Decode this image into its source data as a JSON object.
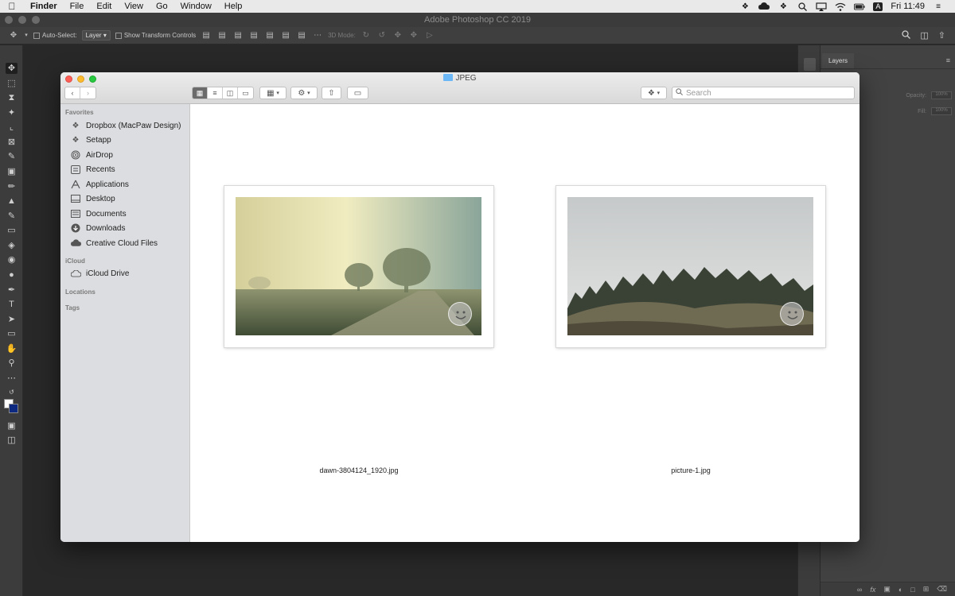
{
  "menubar": {
    "apple": "",
    "app": "Finder",
    "items": [
      "File",
      "Edit",
      "View",
      "Go",
      "Window",
      "Help"
    ],
    "clock": "Fri 11:49",
    "status_icons": [
      "dropbox-status-icon",
      "creative-cloud-icon",
      "dropbox-icon",
      "search-icon",
      "airplay-icon",
      "wifi-icon",
      "battery-icon",
      "input-source-icon",
      "notification-center-icon"
    ],
    "input_source": "A"
  },
  "photoshop": {
    "title": "Adobe Photoshop CC 2019",
    "options": {
      "auto_select_label": "Auto-Select:",
      "layer_value": "Layer",
      "transform_label": "Show Transform Controls",
      "mode_3d_label": "3D Mode:"
    },
    "layers_tab": "Layers",
    "opacity_label": "Opacity:",
    "opacity_value": "100%",
    "fill_label": "Fill:",
    "fill_value": "100%",
    "colors": {
      "foreground": "#ffffff",
      "background": "#0d2a80"
    }
  },
  "finder": {
    "title": "JPEG",
    "search_placeholder": "Search",
    "sidebar": {
      "favorites_header": "Favorites",
      "favorites": [
        {
          "label": "Dropbox (MacPaw Design)",
          "icon": "dropbox-icon"
        },
        {
          "label": "Setapp",
          "icon": "setapp-icon"
        },
        {
          "label": "AirDrop",
          "icon": "airdrop-icon"
        },
        {
          "label": "Recents",
          "icon": "recents-icon"
        },
        {
          "label": "Applications",
          "icon": "applications-icon"
        },
        {
          "label": "Desktop",
          "icon": "desktop-icon"
        },
        {
          "label": "Documents",
          "icon": "documents-icon"
        },
        {
          "label": "Downloads",
          "icon": "downloads-icon"
        },
        {
          "label": "Creative Cloud Files",
          "icon": "creative-cloud-icon"
        }
      ],
      "icloud_header": "iCloud",
      "icloud": [
        {
          "label": "iCloud Drive",
          "icon": "cloud-icon"
        }
      ],
      "locations_header": "Locations",
      "tags_header": "Tags"
    },
    "files": [
      {
        "name": "dawn-3804124_1920.jpg"
      },
      {
        "name": "picture-1.jpg"
      }
    ]
  }
}
